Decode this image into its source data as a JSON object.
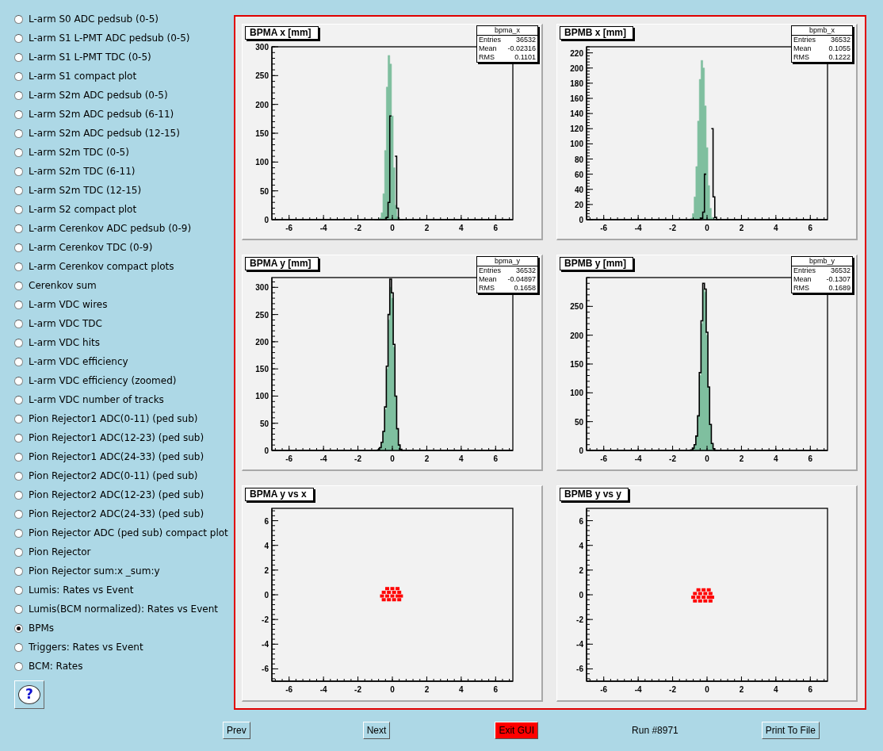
{
  "sidebar": {
    "items": [
      {
        "label": "L-arm S0 ADC pedsub (0-5)",
        "selected": false
      },
      {
        "label": "L-arm S1 L-PMT ADC pedsub (0-5)",
        "selected": false
      },
      {
        "label": "L-arm S1 L-PMT TDC (0-5)",
        "selected": false
      },
      {
        "label": "L-arm S1 compact plot",
        "selected": false
      },
      {
        "label": "L-arm S2m ADC pedsub (0-5)",
        "selected": false
      },
      {
        "label": "L-arm S2m ADC pedsub (6-11)",
        "selected": false
      },
      {
        "label": "L-arm S2m ADC pedsub (12-15)",
        "selected": false
      },
      {
        "label": "L-arm S2m TDC (0-5)",
        "selected": false
      },
      {
        "label": "L-arm S2m TDC (6-11)",
        "selected": false
      },
      {
        "label": "L-arm S2m TDC (12-15)",
        "selected": false
      },
      {
        "label": "L-arm S2 compact plot",
        "selected": false
      },
      {
        "label": "L-arm Cerenkov ADC pedsub (0-9)",
        "selected": false
      },
      {
        "label": "L-arm Cerenkov TDC (0-9)",
        "selected": false
      },
      {
        "label": "L-arm Cerenkov compact plots",
        "selected": false
      },
      {
        "label": "Cerenkov sum",
        "selected": false
      },
      {
        "label": "L-arm VDC wires",
        "selected": false
      },
      {
        "label": "L-arm VDC TDC",
        "selected": false
      },
      {
        "label": "L-arm VDC hits",
        "selected": false
      },
      {
        "label": "L-arm VDC efficiency",
        "selected": false
      },
      {
        "label": "L-arm VDC efficiency (zoomed)",
        "selected": false
      },
      {
        "label": "L-arm VDC number of tracks",
        "selected": false
      },
      {
        "label": "Pion Rejector1 ADC(0-11) (ped sub)",
        "selected": false
      },
      {
        "label": "Pion Rejector1 ADC(12-23) (ped sub)",
        "selected": false
      },
      {
        "label": "Pion Rejector1 ADC(24-33) (ped sub)",
        "selected": false
      },
      {
        "label": "Pion Rejector2 ADC(0-11) (ped sub)",
        "selected": false
      },
      {
        "label": "Pion Rejector2 ADC(12-23) (ped sub)",
        "selected": false
      },
      {
        "label": "Pion Rejector2 ADC(24-33) (ped sub)",
        "selected": false
      },
      {
        "label": "Pion Rejector ADC (ped sub) compact plot",
        "selected": false
      },
      {
        "label": "Pion Rejector",
        "selected": false
      },
      {
        "label": "Pion Rejector sum:x _sum:y",
        "selected": false
      },
      {
        "label": "Lumis: Rates vs Event",
        "selected": false
      },
      {
        "label": "Lumis(BCM normalized): Rates vs Event",
        "selected": false
      },
      {
        "label": "BPMs",
        "selected": true
      },
      {
        "label": "Triggers: Rates vs Event",
        "selected": false
      },
      {
        "label": "BCM: Rates",
        "selected": false
      }
    ],
    "help_button": {
      "label": "?"
    }
  },
  "canvas": {
    "pads": [
      {
        "title": "BPMA x [mm]",
        "stats": {
          "name": "bpma_x",
          "rows": [
            {
              "label": "Entries",
              "value": "36532"
            },
            {
              "label": "Mean",
              "value": "-0.02316"
            },
            {
              "label": "RMS",
              "value": "0.1101"
            }
          ]
        },
        "chart_data": {
          "type": "area",
          "x": [
            -1.0,
            -0.9,
            -0.8,
            -0.7,
            -0.6,
            -0.5,
            -0.4,
            -0.3,
            -0.2,
            -0.1,
            0.0,
            0.1,
            0.2,
            0.3,
            0.4,
            0.5,
            0.6
          ],
          "xlim": [
            -7,
            7
          ],
          "ylim": [
            0,
            300
          ],
          "xticks": [
            -6,
            -4,
            -2,
            0,
            2,
            4,
            6
          ],
          "yticks": [
            0,
            50,
            100,
            150,
            200,
            250,
            300
          ],
          "series": [
            {
              "type": "area",
              "color": "#7fbf9f",
              "values": [
                0,
                0,
                0,
                3,
                12,
                45,
                120,
                230,
                285,
                270,
                180,
                90,
                25,
                5,
                0,
                0,
                0
              ]
            },
            {
              "type": "line",
              "color": "#000000",
              "values": [
                0,
                0,
                0,
                0,
                0,
                0,
                0,
                4,
                30,
                180,
                null,
                null,
                110,
                20,
                0,
                0,
                0
              ]
            }
          ]
        }
      },
      {
        "title": "BPMB x [mm]",
        "stats": {
          "name": "bpmb_x",
          "rows": [
            {
              "label": "Entries",
              "value": "36532"
            },
            {
              "label": "Mean",
              "value": "0.1055"
            },
            {
              "label": "RMS",
              "value": "0.1222"
            }
          ]
        },
        "chart_data": {
          "type": "area",
          "x": [
            -1.0,
            -0.9,
            -0.8,
            -0.7,
            -0.6,
            -0.5,
            -0.4,
            -0.3,
            -0.2,
            -0.1,
            0.0,
            0.1,
            0.2,
            0.3,
            0.4,
            0.5,
            0.6
          ],
          "xlim": [
            -7,
            7
          ],
          "ylim": [
            0,
            228
          ],
          "xticks": [
            -6,
            -4,
            -2,
            0,
            2,
            4,
            6
          ],
          "yticks": [
            0,
            20,
            40,
            60,
            80,
            100,
            120,
            140,
            160,
            180,
            200,
            220
          ],
          "series": [
            {
              "type": "area",
              "color": "#7fbf9f",
              "values": [
                0,
                2,
                8,
                30,
                70,
                130,
                185,
                210,
                200,
                150,
                95,
                45,
                15,
                3,
                0,
                0,
                0
              ]
            },
            {
              "type": "line",
              "color": "#000000",
              "values": [
                0,
                0,
                0,
                0,
                0,
                0,
                0,
                2,
                10,
                60,
                null,
                null,
                null,
                120,
                30,
                3,
                0
              ]
            }
          ]
        }
      },
      {
        "title": "BPMA y [mm]",
        "stats": {
          "name": "bpma_y",
          "rows": [
            {
              "label": "Entries",
              "value": "36532"
            },
            {
              "label": "Mean",
              "value": "-0.04897"
            },
            {
              "label": "RMS",
              "value": "0.1658"
            }
          ]
        },
        "chart_data": {
          "type": "area",
          "x": [
            -1.0,
            -0.9,
            -0.8,
            -0.7,
            -0.6,
            -0.5,
            -0.4,
            -0.3,
            -0.2,
            -0.1,
            0.0,
            0.1,
            0.2,
            0.3,
            0.4,
            0.5,
            0.6
          ],
          "xlim": [
            -7,
            7
          ],
          "ylim": [
            0,
            318
          ],
          "xticks": [
            -6,
            -4,
            -2,
            0,
            2,
            4,
            6
          ],
          "yticks": [
            0,
            50,
            100,
            150,
            200,
            250,
            300
          ],
          "series": [
            {
              "type": "area",
              "color": "#7fbf9f",
              "values": [
                0,
                0,
                2,
                6,
                15,
                35,
                75,
                150,
                240,
                300,
                280,
                190,
                100,
                40,
                10,
                2,
                0
              ]
            },
            {
              "type": "line",
              "color": "#000000",
              "values": [
                0,
                0,
                1,
                5,
                15,
                35,
                80,
                155,
                250,
                315,
                290,
                195,
                100,
                40,
                10,
                2,
                0
              ]
            }
          ]
        }
      },
      {
        "title": "BPMB y [mm]",
        "stats": {
          "name": "bpmb_y",
          "rows": [
            {
              "label": "Entries",
              "value": "36532"
            },
            {
              "label": "Mean",
              "value": "-0.1307"
            },
            {
              "label": "RMS",
              "value": "0.1689"
            }
          ]
        },
        "chart_data": {
          "type": "area",
          "x": [
            -1.0,
            -0.9,
            -0.8,
            -0.7,
            -0.6,
            -0.5,
            -0.4,
            -0.3,
            -0.2,
            -0.1,
            0.0,
            0.1,
            0.2,
            0.3,
            0.4,
            0.5,
            0.6
          ],
          "xlim": [
            -7,
            7
          ],
          "ylim": [
            0,
            300
          ],
          "xticks": [
            -6,
            -4,
            -2,
            0,
            2,
            4,
            6
          ],
          "yticks": [
            0,
            50,
            100,
            150,
            200,
            250
          ],
          "series": [
            {
              "type": "area",
              "color": "#7fbf9f",
              "values": [
                0,
                1,
                4,
                10,
                25,
                60,
                130,
                220,
                280,
                275,
                200,
                110,
                45,
                12,
                3,
                0,
                0
              ]
            },
            {
              "type": "line",
              "color": "#000000",
              "values": [
                0,
                1,
                4,
                10,
                25,
                60,
                135,
                225,
                290,
                280,
                205,
                110,
                45,
                12,
                3,
                0,
                0
              ]
            }
          ]
        }
      },
      {
        "title": "BPMA y vs x",
        "chart_data": {
          "type": "scatter",
          "xlim": [
            -7,
            7
          ],
          "ylim": [
            -7,
            7
          ],
          "xticks": [
            -6,
            -4,
            -2,
            0,
            2,
            4,
            6
          ],
          "yticks": [
            -6,
            -4,
            -2,
            0,
            2,
            4,
            6
          ],
          "series": [
            {
              "color": "#ff0000",
              "x": [
                -0.5,
                -0.2,
                0.1,
                0.4,
                -0.6,
                -0.3,
                0.0,
                0.3,
                0.5,
                -0.5,
                -0.2,
                0.1,
                0.4,
                -0.3,
                0.0,
                0.3
              ],
              "values": [
                -0.4,
                -0.4,
                -0.4,
                -0.4,
                -0.1,
                -0.1,
                -0.1,
                -0.1,
                -0.1,
                0.2,
                0.2,
                0.2,
                0.2,
                0.5,
                0.5,
                0.5
              ]
            }
          ]
        }
      },
      {
        "title": "BPMB y vs y",
        "chart_data": {
          "type": "scatter",
          "xlim": [
            -7,
            7
          ],
          "ylim": [
            -7,
            7
          ],
          "xticks": [
            -6,
            -4,
            -2,
            0,
            2,
            4,
            6
          ],
          "yticks": [
            -6,
            -4,
            -2,
            0,
            2,
            4,
            6
          ],
          "series": [
            {
              "color": "#ff0000",
              "x": [
                -0.7,
                -0.4,
                -0.1,
                0.2,
                -0.8,
                -0.5,
                -0.2,
                0.1,
                0.3,
                -0.7,
                -0.4,
                -0.1,
                0.2,
                -0.5,
                -0.2,
                0.1
              ],
              "values": [
                -0.5,
                -0.5,
                -0.5,
                -0.5,
                -0.2,
                -0.2,
                -0.2,
                -0.2,
                -0.2,
                0.1,
                0.1,
                0.1,
                0.1,
                0.4,
                0.4,
                0.4
              ]
            }
          ]
        }
      }
    ]
  },
  "footer": {
    "prev": "Prev",
    "next": "Next",
    "exit": "Exit GUI",
    "run": "Run #8971",
    "print": "Print To File"
  }
}
